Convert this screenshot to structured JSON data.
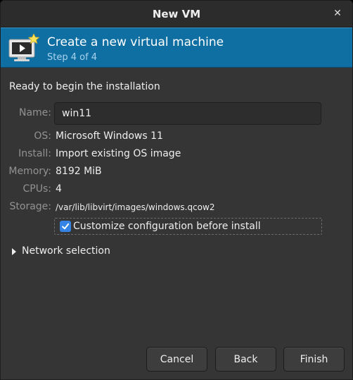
{
  "window": {
    "title": "New VM"
  },
  "banner": {
    "title": "Create a new virtual machine",
    "step": "Step 4 of 4",
    "color": "#0f6ea2"
  },
  "summary": {
    "heading": "Ready to begin the installation",
    "name_label": "Name:",
    "name_value": "win11",
    "os_label": "OS:",
    "os_value": "Microsoft Windows 11",
    "install_label": "Install:",
    "install_value": "Import existing OS image",
    "memory_label": "Memory:",
    "memory_value": "8192 MiB",
    "cpus_label": "CPUs:",
    "cpus_value": "4",
    "storage_label": "Storage:",
    "storage_value": "/var/lib/libvirt/images/windows.qcow2"
  },
  "customize": {
    "label": "Customize configuration before install",
    "checked": true,
    "accent": "#3584e4"
  },
  "network": {
    "label": "Network selection",
    "expanded": false
  },
  "buttons": {
    "cancel": "Cancel",
    "back": "Back",
    "finish": "Finish"
  }
}
